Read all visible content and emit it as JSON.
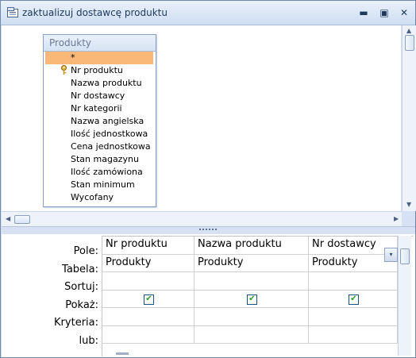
{
  "window": {
    "title": "zaktualizuj dostawcę produktu",
    "minimize_icon": "minimize-icon",
    "maximize_icon": "maximize-icon",
    "close_icon": "close-icon",
    "close_label": "✕",
    "minimize_label": "▬",
    "maximize_label": "▣"
  },
  "table": {
    "name": "Produkty",
    "fields": [
      {
        "label": "*",
        "selected": true,
        "key": false
      },
      {
        "label": "Nr produktu",
        "selected": false,
        "key": true
      },
      {
        "label": "Nazwa produktu",
        "selected": false,
        "key": false
      },
      {
        "label": "Nr dostawcy",
        "selected": false,
        "key": false
      },
      {
        "label": "Nr kategorii",
        "selected": false,
        "key": false
      },
      {
        "label": "Nazwa angielska",
        "selected": false,
        "key": false
      },
      {
        "label": "Ilość jednostkowa",
        "selected": false,
        "key": false
      },
      {
        "label": "Cena jednostkowa",
        "selected": false,
        "key": false
      },
      {
        "label": "Stan magazynu",
        "selected": false,
        "key": false
      },
      {
        "label": "Ilość zamówiona",
        "selected": false,
        "key": false
      },
      {
        "label": "Stan minimum",
        "selected": false,
        "key": false
      },
      {
        "label": "Wycofany",
        "selected": false,
        "key": false
      }
    ]
  },
  "grid": {
    "row_labels": [
      "Pole:",
      "Tabela:",
      "Sortuj:",
      "Pokaż:",
      "Kryteria:",
      "lub:"
    ],
    "columns": [
      {
        "pole": "Nr produktu",
        "tabela": "Produkty",
        "sortuj": "",
        "pokaz": true,
        "kryteria": "",
        "lub": ""
      },
      {
        "pole": "Nazwa produktu",
        "tabela": "Produkty",
        "sortuj": "",
        "pokaz": true,
        "kryteria": "",
        "lub": ""
      },
      {
        "pole": "Nr dostawcy",
        "tabela": "Produkty",
        "sortuj": "",
        "pokaz": true,
        "kryteria": "",
        "lub": ""
      }
    ],
    "check_glyph": "✔",
    "dropdown_glyph": "▾"
  },
  "colors": {
    "selected_field": "#f9b878",
    "frame": "#d6e2f3",
    "title_text": "#1e395b"
  }
}
